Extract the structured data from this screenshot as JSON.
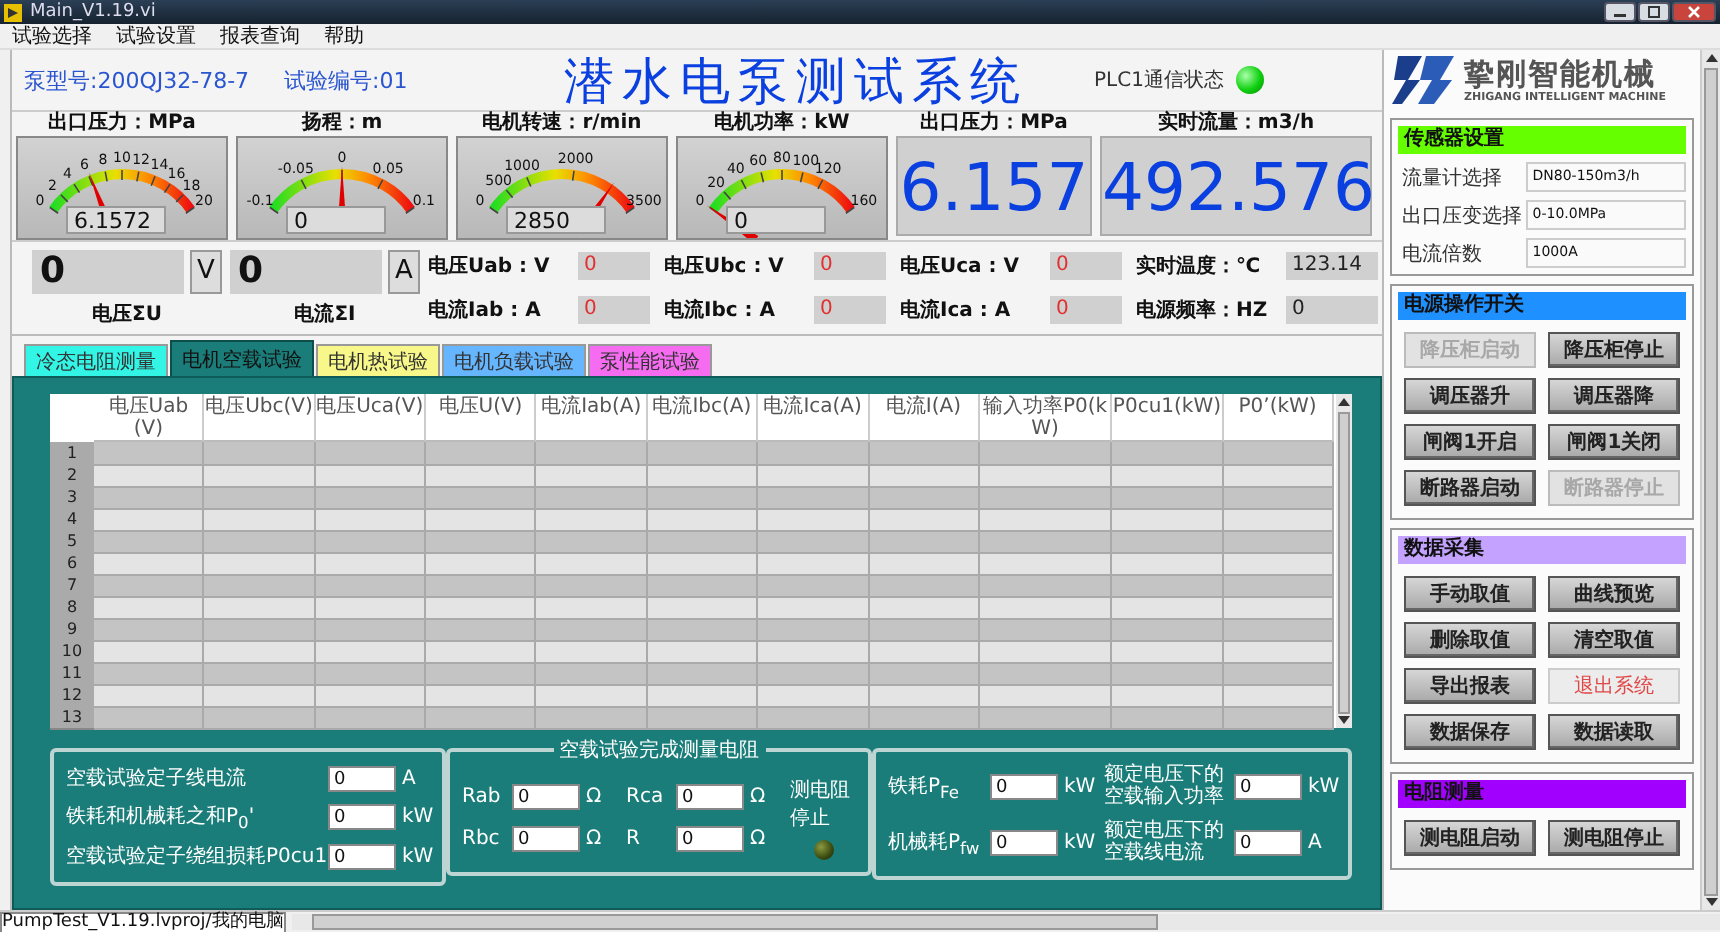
{
  "window": {
    "title": "Main_V1.19.vi"
  },
  "menu": [
    "试验选择",
    "试验设置",
    "报表查询",
    "帮助"
  ],
  "header": {
    "pump_model": "泵型号:200QJ32-78-7",
    "test_number": "试验编号:01",
    "title": "潜水电泵测试系统",
    "plc_status": {
      "label": "PLC1通信状态",
      "on": true
    }
  },
  "logo": {
    "name": "挚刚智能机械",
    "subtitle": "ZHIGANG INTELLIGENT MACHINE"
  },
  "gauges": [
    {
      "label": "出口压力：MPa",
      "ticks": [
        "0",
        "2",
        "4",
        "6",
        "8",
        "10",
        "12",
        "14",
        "16",
        "18",
        "20"
      ],
      "reading": "6.1572"
    },
    {
      "label": "扬程：m",
      "ticks": [
        "-0.1",
        "-0.05",
        "0",
        "0.05",
        "0.1"
      ],
      "reading": "0"
    },
    {
      "label": "电机转速：r/min",
      "ticks": [
        "0",
        "500",
        "1000",
        "2000",
        "3500"
      ],
      "reading": "2850"
    },
    {
      "label": "电机功率：kW",
      "ticks": [
        "0",
        "20",
        "40",
        "60",
        "80",
        "100",
        "120",
        "160"
      ],
      "reading": "0"
    }
  ],
  "big_readouts": [
    {
      "label": "出口压力：MPa",
      "value": "6.157"
    },
    {
      "label": "实时流量：m3/h",
      "value": "492.576"
    }
  ],
  "sensor_settings": {
    "title": "传感器设置",
    "color": "#66ff00",
    "fields": [
      {
        "label": "流量计选择",
        "value": "DN80-150m3/h"
      },
      {
        "label": "出口压变选择",
        "value": "0-10.0MPa"
      },
      {
        "label": "电流倍数",
        "value": "1000A"
      }
    ]
  },
  "totals": [
    {
      "value": "0",
      "unit": "V",
      "label": "电压ΣU"
    },
    {
      "value": "0",
      "unit": "A",
      "label": "电流ΣI"
    }
  ],
  "readings": [
    {
      "label": "电压Uab : V",
      "value": "0",
      "kind": "electrical"
    },
    {
      "label": "电流Iab : A",
      "value": "0",
      "kind": "electrical"
    },
    {
      "label": "电压Ubc : V",
      "value": "0",
      "kind": "electrical"
    },
    {
      "label": "电流Ibc : A",
      "value": "0",
      "kind": "electrical"
    },
    {
      "label": "电压Uca : V",
      "value": "0",
      "kind": "electrical"
    },
    {
      "label": "电流Ica : A",
      "value": "0",
      "kind": "electrical"
    },
    {
      "label": "实时温度：℃",
      "value": "123.14",
      "kind": "environment"
    },
    {
      "label": "电源频率：HZ",
      "value": "0",
      "kind": "environment"
    }
  ],
  "tabs": [
    {
      "label": "冷态电阻测量",
      "color": "#33f5e6",
      "selected": false
    },
    {
      "label": "电机空载试验",
      "color": "#1a7d79",
      "selected": true
    },
    {
      "label": "电机热试验",
      "color": "#f7f78a",
      "selected": false
    },
    {
      "label": "电机负载试验",
      "color": "#66b5ff",
      "selected": false
    },
    {
      "label": "泵性能试验",
      "color": "#f56cf0",
      "selected": false
    }
  ],
  "table": {
    "columns": [
      "电压Uab(V)",
      "电压Ubc(V)",
      "电压Uca(V)",
      "电压U(V)",
      "电流Iab(A)",
      "电流Ibc(A)",
      "电流Ica(A)",
      "电流I(A)",
      "输入功率P0(kW)",
      "P0cu1(kW)",
      "P0’(kW)"
    ],
    "rows": [
      "1",
      "2",
      "3",
      "4",
      "5",
      "6",
      "7",
      "8",
      "9",
      "10",
      "11",
      "12",
      "13"
    ]
  },
  "no_load_panel": {
    "fields": [
      {
        "label": "空载试验定子线电流",
        "value": "0",
        "unit": "A"
      },
      {
        "label": "铁耗和机械耗之和P$_{0}$'",
        "value": "0",
        "unit": "kW"
      },
      {
        "label": "空载试验定子绕组损耗P0cu1",
        "value": "0",
        "unit": "kW"
      }
    ]
  },
  "resistance_panel": {
    "title": "空载试验完成测量电阻",
    "fields": [
      {
        "label": "Rab",
        "value": "0",
        "unit": "Ω"
      },
      {
        "label": "Rca",
        "value": "0",
        "unit": "Ω"
      },
      {
        "label": "Rbc",
        "value": "0",
        "unit": "Ω"
      },
      {
        "label": "R",
        "value": "0",
        "unit": "Ω"
      }
    ],
    "indicator": {
      "label": "测电阻停止",
      "on": false
    }
  },
  "loss_panel": {
    "fields": [
      {
        "label": "铁耗P$_{Fe}$",
        "value": "0",
        "unit": "kW"
      },
      {
        "label": "额定电压下的空载输入功率",
        "value": "0",
        "unit": "kW"
      },
      {
        "label": "机械耗P$_{fw}$",
        "value": "0",
        "unit": "kW"
      },
      {
        "label": "额定电压下的空载线电流",
        "value": "0",
        "unit": "A"
      }
    ]
  },
  "sections": [
    {
      "title": "电源操作开关",
      "color": "#1e90ff",
      "buttons": [
        {
          "label": "降压柜启动",
          "disabled": true,
          "kind": "normal"
        },
        {
          "label": "降压柜停止",
          "disabled": false,
          "kind": "normal"
        },
        {
          "label": "调压器升",
          "disabled": false,
          "kind": "normal"
        },
        {
          "label": "调压器降",
          "disabled": false,
          "kind": "normal"
        },
        {
          "label": "闸阀1开启",
          "disabled": false,
          "kind": "normal"
        },
        {
          "label": "闸阀1关闭",
          "disabled": false,
          "kind": "normal"
        },
        {
          "label": "断路器启动",
          "disabled": false,
          "kind": "normal"
        },
        {
          "label": "断路器停止",
          "disabled": true,
          "kind": "normal"
        }
      ]
    },
    {
      "title": "数据采集",
      "color": "#c3a3ff",
      "buttons": [
        {
          "label": "手动取值",
          "disabled": false,
          "kind": "normal"
        },
        {
          "label": "曲线预览",
          "disabled": false,
          "kind": "normal"
        },
        {
          "label": "删除取值",
          "disabled": false,
          "kind": "normal"
        },
        {
          "label": "清空取值",
          "disabled": false,
          "kind": "normal"
        },
        {
          "label": "导出报表",
          "disabled": false,
          "kind": "normal"
        },
        {
          "label": "退出系统",
          "disabled": false,
          "kind": "exit"
        },
        {
          "label": "数据保存",
          "disabled": false,
          "kind": "normal"
        },
        {
          "label": "数据读取",
          "disabled": false,
          "kind": "normal"
        }
      ]
    },
    {
      "title": "电阻测量",
      "color": "#a100ff",
      "buttons": [
        {
          "label": "测电阻启动",
          "disabled": false,
          "kind": "normal"
        },
        {
          "label": "测电阻停止",
          "disabled": false,
          "kind": "normal"
        }
      ]
    }
  ],
  "status_bar": {
    "path": "PumpTest_V1.19.lvproj/我的电脑"
  }
}
